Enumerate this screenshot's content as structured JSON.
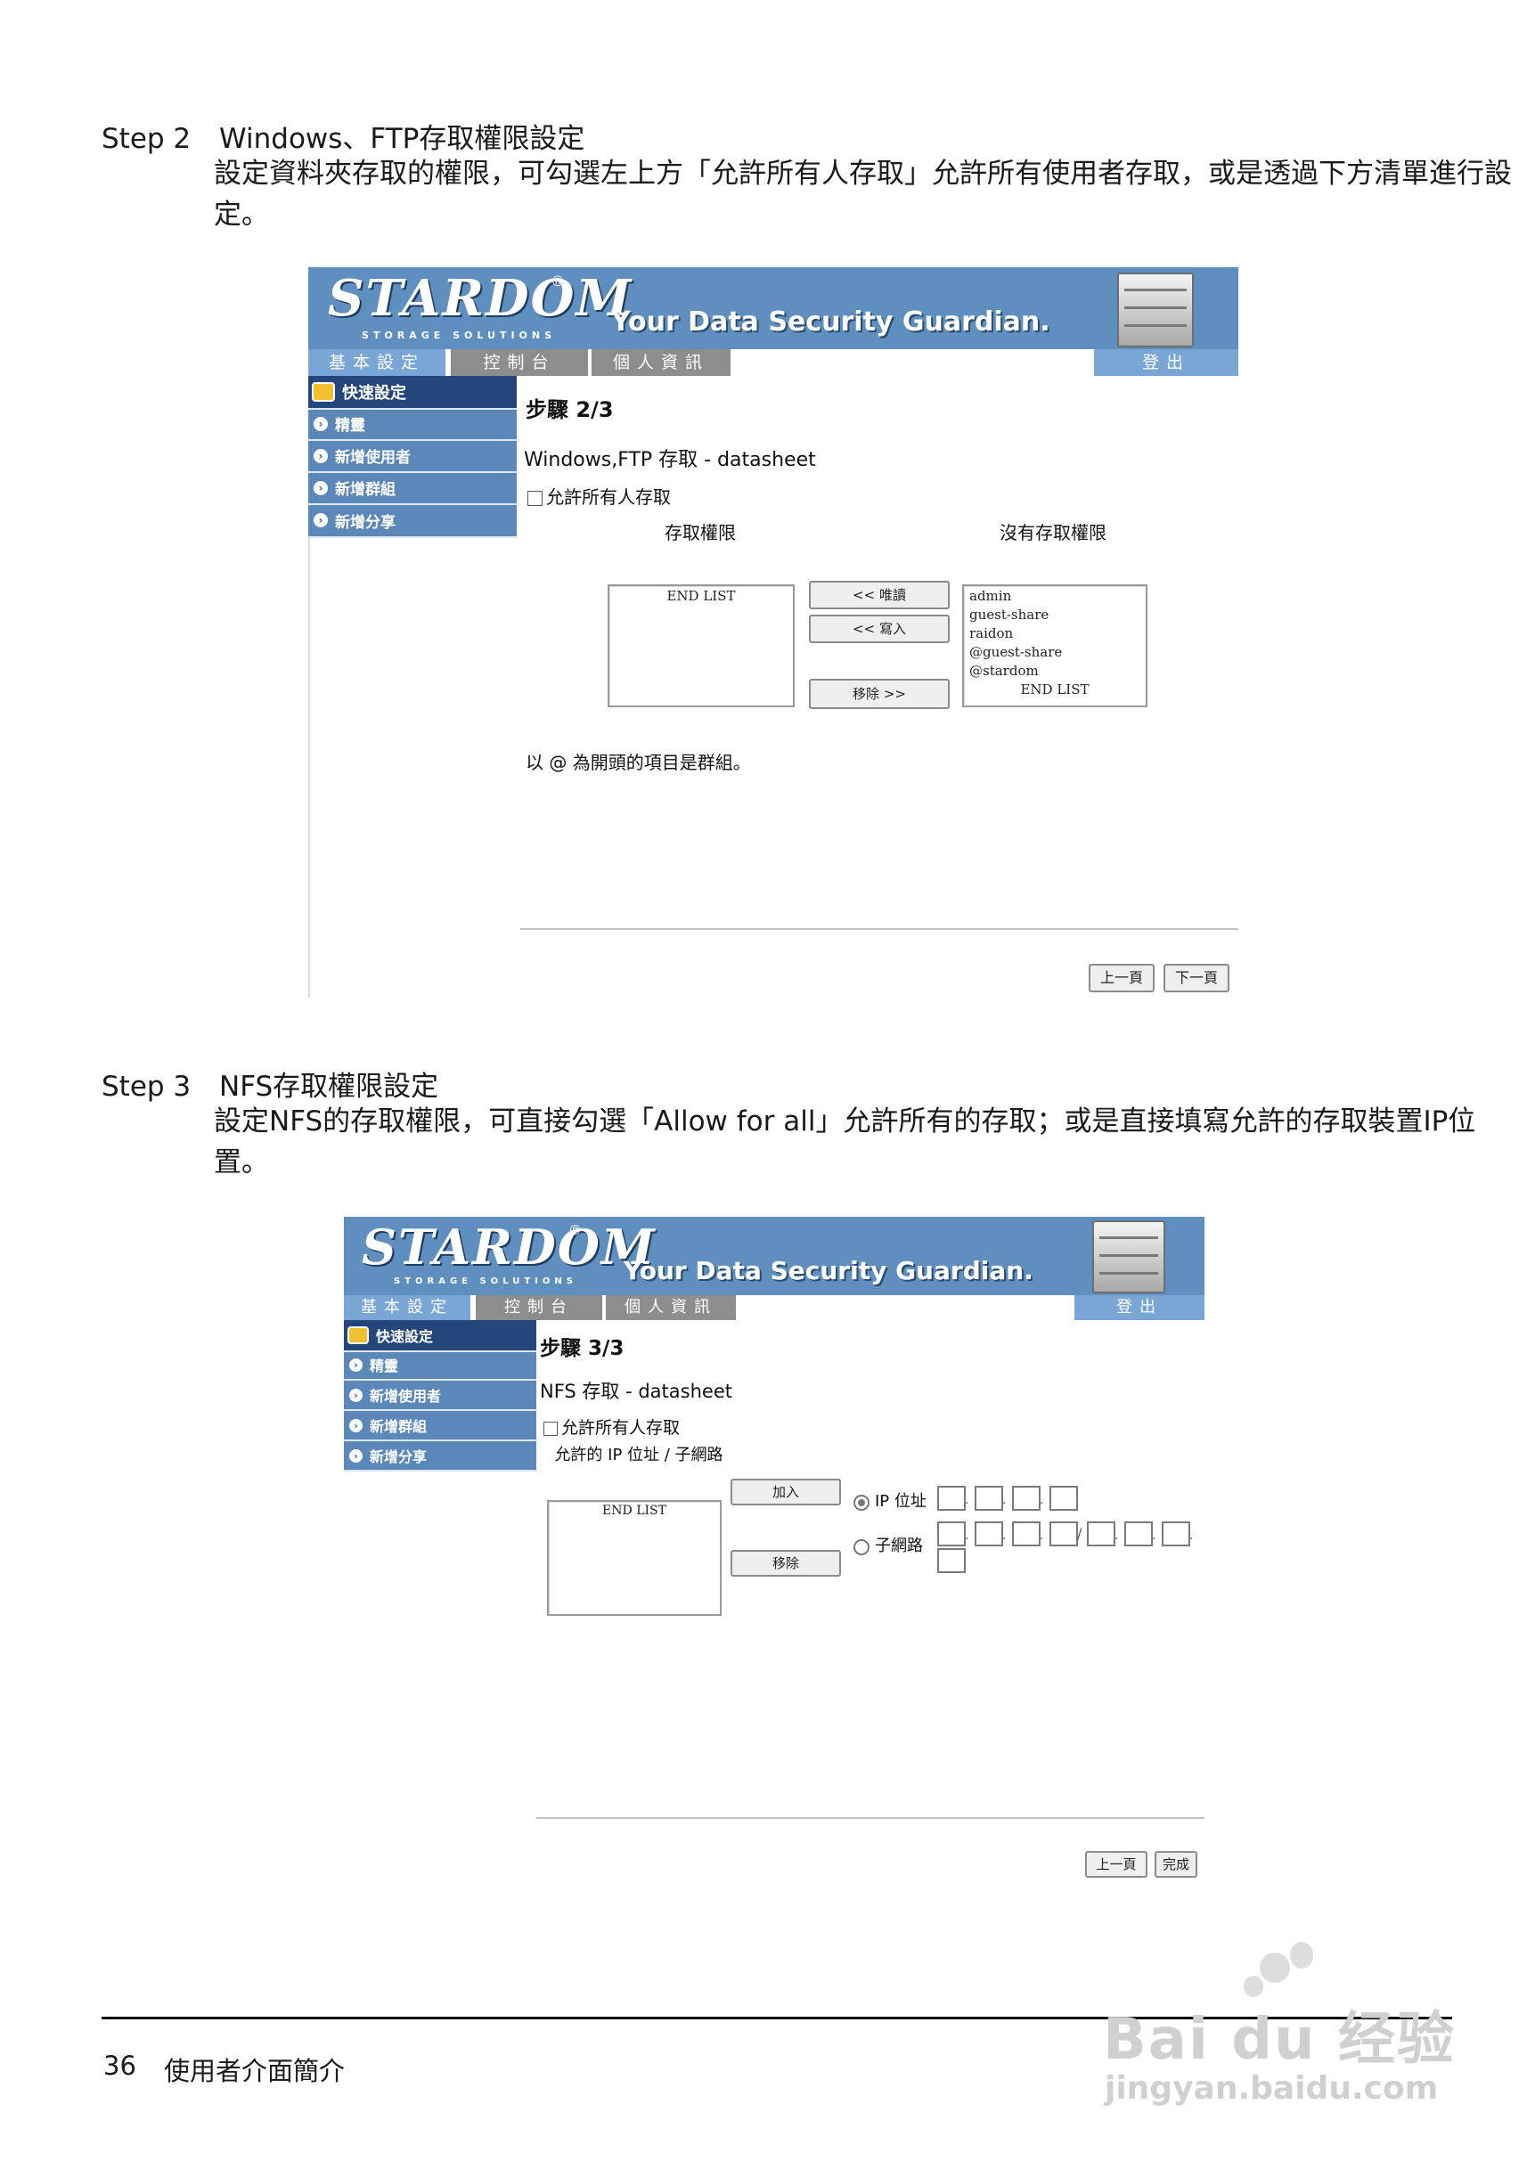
{
  "step2": {
    "label": "Step 2",
    "title": "Windows、FTP存取權限設定",
    "description": "設定資料夾存取的權限，可勾選左上方「允許所有人存取」允許所有使用者存取，或是透過下方清單進行設定。"
  },
  "step3": {
    "label": "Step 3",
    "title": "NFS存取權限設定",
    "description": "設定NFS的存取權限，可直接勾選「Allow for all」允許所有的存取；或是直接填寫允許的存取裝置IP位置。"
  },
  "nas_ui": {
    "logo": "STARDOM",
    "logo_sub": "STORAGE SOLUTIONS",
    "logo_reg": "®",
    "tagline": "Your Data Security Guardian.",
    "tabs": [
      "基本設定",
      "控制台",
      "個人資訊"
    ],
    "logout": "登出",
    "sidebar": [
      "快速設定",
      "精靈",
      "新增使用者",
      "新增群組",
      "新增分享"
    ]
  },
  "screen1": {
    "step_title": "步驟 2/3",
    "share_title": "Windows,FTP 存取 - datasheet",
    "allow_all": "允許所有人存取",
    "col_access": "存取權限",
    "col_no_access": "沒有存取權限",
    "access_list": [
      "END LIST"
    ],
    "no_access_list": [
      "admin",
      "guest-share",
      "raidon",
      "@guest-share",
      "@stardom",
      "END LIST"
    ],
    "btn_read_only": "<< 唯讀",
    "btn_write": "<< 寫入",
    "btn_remove": "移除 >>",
    "group_note": "以 @ 為開頭的項目是群組。",
    "btn_prev": "上一頁",
    "btn_next": "下一頁"
  },
  "screen2": {
    "step_title": "步驟 3/3",
    "share_title": "NFS 存取 - datasheet",
    "allow_all": "允許所有人存取",
    "list_label": "允許的 IP 位址 / 子網路",
    "list": [
      "END LIST"
    ],
    "btn_add": "加入",
    "btn_remove": "移除",
    "radio_ip": "IP 位址",
    "radio_subnet": "子網路",
    "btn_prev": "上一頁",
    "btn_finish": "完成"
  },
  "footer": {
    "page_number": "36",
    "section": "使用者介面簡介"
  },
  "watermark": {
    "brand": "Bai du 经验",
    "url": "jingyan.baidu.com"
  }
}
